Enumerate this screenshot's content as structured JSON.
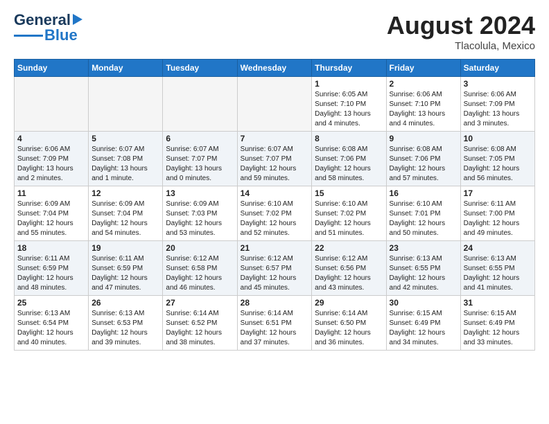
{
  "header": {
    "logo_line1": "General",
    "logo_line2": "Blue",
    "month_year": "August 2024",
    "location": "Tlacolula, Mexico"
  },
  "days_of_week": [
    "Sunday",
    "Monday",
    "Tuesday",
    "Wednesday",
    "Thursday",
    "Friday",
    "Saturday"
  ],
  "weeks": [
    [
      {
        "day": "",
        "info": ""
      },
      {
        "day": "",
        "info": ""
      },
      {
        "day": "",
        "info": ""
      },
      {
        "day": "",
        "info": ""
      },
      {
        "day": "1",
        "info": "Sunrise: 6:05 AM\nSunset: 7:10 PM\nDaylight: 13 hours\nand 4 minutes."
      },
      {
        "day": "2",
        "info": "Sunrise: 6:06 AM\nSunset: 7:10 PM\nDaylight: 13 hours\nand 4 minutes."
      },
      {
        "day": "3",
        "info": "Sunrise: 6:06 AM\nSunset: 7:09 PM\nDaylight: 13 hours\nand 3 minutes."
      }
    ],
    [
      {
        "day": "4",
        "info": "Sunrise: 6:06 AM\nSunset: 7:09 PM\nDaylight: 13 hours\nand 2 minutes."
      },
      {
        "day": "5",
        "info": "Sunrise: 6:07 AM\nSunset: 7:08 PM\nDaylight: 13 hours\nand 1 minute."
      },
      {
        "day": "6",
        "info": "Sunrise: 6:07 AM\nSunset: 7:07 PM\nDaylight: 13 hours\nand 0 minutes."
      },
      {
        "day": "7",
        "info": "Sunrise: 6:07 AM\nSunset: 7:07 PM\nDaylight: 12 hours\nand 59 minutes."
      },
      {
        "day": "8",
        "info": "Sunrise: 6:08 AM\nSunset: 7:06 PM\nDaylight: 12 hours\nand 58 minutes."
      },
      {
        "day": "9",
        "info": "Sunrise: 6:08 AM\nSunset: 7:06 PM\nDaylight: 12 hours\nand 57 minutes."
      },
      {
        "day": "10",
        "info": "Sunrise: 6:08 AM\nSunset: 7:05 PM\nDaylight: 12 hours\nand 56 minutes."
      }
    ],
    [
      {
        "day": "11",
        "info": "Sunrise: 6:09 AM\nSunset: 7:04 PM\nDaylight: 12 hours\nand 55 minutes."
      },
      {
        "day": "12",
        "info": "Sunrise: 6:09 AM\nSunset: 7:04 PM\nDaylight: 12 hours\nand 54 minutes."
      },
      {
        "day": "13",
        "info": "Sunrise: 6:09 AM\nSunset: 7:03 PM\nDaylight: 12 hours\nand 53 minutes."
      },
      {
        "day": "14",
        "info": "Sunrise: 6:10 AM\nSunset: 7:02 PM\nDaylight: 12 hours\nand 52 minutes."
      },
      {
        "day": "15",
        "info": "Sunrise: 6:10 AM\nSunset: 7:02 PM\nDaylight: 12 hours\nand 51 minutes."
      },
      {
        "day": "16",
        "info": "Sunrise: 6:10 AM\nSunset: 7:01 PM\nDaylight: 12 hours\nand 50 minutes."
      },
      {
        "day": "17",
        "info": "Sunrise: 6:11 AM\nSunset: 7:00 PM\nDaylight: 12 hours\nand 49 minutes."
      }
    ],
    [
      {
        "day": "18",
        "info": "Sunrise: 6:11 AM\nSunset: 6:59 PM\nDaylight: 12 hours\nand 48 minutes."
      },
      {
        "day": "19",
        "info": "Sunrise: 6:11 AM\nSunset: 6:59 PM\nDaylight: 12 hours\nand 47 minutes."
      },
      {
        "day": "20",
        "info": "Sunrise: 6:12 AM\nSunset: 6:58 PM\nDaylight: 12 hours\nand 46 minutes."
      },
      {
        "day": "21",
        "info": "Sunrise: 6:12 AM\nSunset: 6:57 PM\nDaylight: 12 hours\nand 45 minutes."
      },
      {
        "day": "22",
        "info": "Sunrise: 6:12 AM\nSunset: 6:56 PM\nDaylight: 12 hours\nand 43 minutes."
      },
      {
        "day": "23",
        "info": "Sunrise: 6:13 AM\nSunset: 6:55 PM\nDaylight: 12 hours\nand 42 minutes."
      },
      {
        "day": "24",
        "info": "Sunrise: 6:13 AM\nSunset: 6:55 PM\nDaylight: 12 hours\nand 41 minutes."
      }
    ],
    [
      {
        "day": "25",
        "info": "Sunrise: 6:13 AM\nSunset: 6:54 PM\nDaylight: 12 hours\nand 40 minutes."
      },
      {
        "day": "26",
        "info": "Sunrise: 6:13 AM\nSunset: 6:53 PM\nDaylight: 12 hours\nand 39 minutes."
      },
      {
        "day": "27",
        "info": "Sunrise: 6:14 AM\nSunset: 6:52 PM\nDaylight: 12 hours\nand 38 minutes."
      },
      {
        "day": "28",
        "info": "Sunrise: 6:14 AM\nSunset: 6:51 PM\nDaylight: 12 hours\nand 37 minutes."
      },
      {
        "day": "29",
        "info": "Sunrise: 6:14 AM\nSunset: 6:50 PM\nDaylight: 12 hours\nand 36 minutes."
      },
      {
        "day": "30",
        "info": "Sunrise: 6:15 AM\nSunset: 6:49 PM\nDaylight: 12 hours\nand 34 minutes."
      },
      {
        "day": "31",
        "info": "Sunrise: 6:15 AM\nSunset: 6:49 PM\nDaylight: 12 hours\nand 33 minutes."
      }
    ]
  ]
}
